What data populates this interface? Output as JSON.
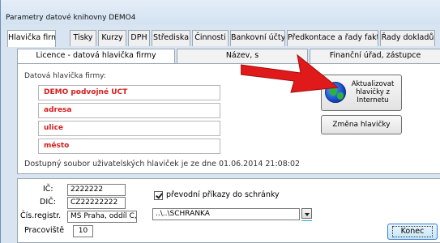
{
  "window": {
    "title": "Parametry datové knihovny  DEMO4"
  },
  "main_tabs": [
    "Hlavička firmy",
    "Tisky",
    "Kurzy",
    "DPH",
    "Střediska",
    "Činnosti",
    "Bankovní účty",
    "Předkontace a řady faktur",
    "Řady dokladů"
  ],
  "sub_tabs": [
    "Licence -  datová hlavička firmy",
    "Název, s",
    "Finanční úřad, zástupce"
  ],
  "header_section": {
    "label": "Datová hlavička firmy:",
    "fields": [
      "DEMO podvojné UCT",
      "adresa",
      "ulice",
      "město"
    ]
  },
  "buttons": {
    "update": "Aktualizovat\nhlavičky z\nInternetu",
    "change": "Změna hlavičky",
    "close": "Konec"
  },
  "availability_text": "Dostupný soubor uživatelských hlaviček je ze dne 01.06.2014 21:08:02",
  "company": {
    "ic_label": "IČ:",
    "ic": "2222222",
    "dic_label": "DIČ:",
    "dic": "CZ22222222",
    "reg_label": "Čís.registr.",
    "reg": "MS Praha, oddíl C, v",
    "workplace_label": "Pracoviště",
    "workplace": "10"
  },
  "payments": {
    "checkbox_label": "převodní příkazy do schránky",
    "checked": true,
    "path": "..\\..\\SCHRANKA"
  },
  "colors": {
    "arrow": "#e01a1a",
    "required_text": "#d81c1c",
    "background": "#3c7fb8"
  },
  "icons": {
    "globe": "globe-icon",
    "arrow": "red-arrow-annotation"
  }
}
